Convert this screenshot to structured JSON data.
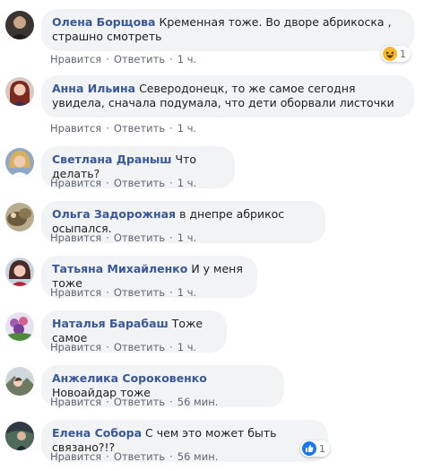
{
  "actions": {
    "like": "Нравится",
    "reply": "Ответить",
    "dot": "·"
  },
  "comments": [
    {
      "author": "Олена Борщова",
      "text": "Кременная тоже. Во дворе абрикоска , страшно смотреть",
      "time": "1 ч.",
      "reaction": {
        "icon": "haha-reaction-icon",
        "count": "1"
      }
    },
    {
      "author": "Анна Ильина",
      "text": "Северодонецк, то же самое сегодня увидела, сначала подумала, что дети оборвали листочки",
      "time": "1 ч."
    },
    {
      "author": "Светлана Драныш",
      "text": "Что делать?",
      "time": "1 ч."
    },
    {
      "author": "Ольга Задорожная",
      "text": "в днепре абрикос осыпался.",
      "time": "1 ч."
    },
    {
      "author": "Татьяна Михайленко",
      "text": "И у меня тоже",
      "time": "1 ч."
    },
    {
      "author": "Наталья Барабаш",
      "text": "Тоже самое",
      "time": "1 ч."
    },
    {
      "author": "Анжелика Сороковенко",
      "text": "Новоайдар тоже",
      "time": "56 мин."
    },
    {
      "author": "Елена Собора",
      "text": "С чем это может быть связано?!?",
      "time": "56 мин.",
      "reaction": {
        "icon": "like-reaction-icon",
        "count": "1"
      }
    }
  ],
  "colors": {
    "author": "#385898",
    "bubble": "#f2f3f5",
    "meta": "#606770",
    "like_blue": "#1877f2",
    "haha_yellow": "#f7b928"
  }
}
